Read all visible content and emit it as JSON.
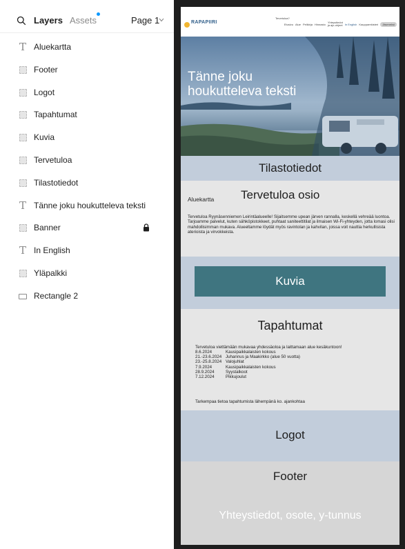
{
  "header": {
    "tab_layers": "Layers",
    "tab_assets": "Assets",
    "page_label": "Page 1"
  },
  "layers": [
    {
      "label": "Aluekartta",
      "icon": "text-icon"
    },
    {
      "label": "Footer",
      "icon": "frame-icon"
    },
    {
      "label": "Logot",
      "icon": "frame-icon"
    },
    {
      "label": "Tapahtumat",
      "icon": "frame-icon"
    },
    {
      "label": "Kuvia",
      "icon": "frame-icon"
    },
    {
      "label": "Tervetuloa",
      "icon": "frame-icon"
    },
    {
      "label": "Tilastotiedot",
      "icon": "frame-icon"
    },
    {
      "label": "Tänne joku houkutteleva teksti",
      "icon": "text-icon"
    },
    {
      "label": "Banner",
      "icon": "frame-icon",
      "locked": true
    },
    {
      "label": "In English",
      "icon": "text-icon"
    },
    {
      "label": "Yläpalkki",
      "icon": "frame-icon"
    },
    {
      "label": "Rectangle 2",
      "icon": "rectangle-icon"
    }
  ],
  "site": {
    "logo": "RAPAPIIRI",
    "nav_over": "Tervetuloa?",
    "nav": [
      "Etusivu",
      "Alue",
      "Pelikirja",
      "Hinnasto"
    ],
    "nav_contact_1": "Yhteystiedot",
    "nav_contact_2": "ja ajo-ohjeet",
    "nav_english": "In English",
    "nav_extra": "Kaupparekisteri",
    "nav_button": "Jäseneksi",
    "hero_text": "Tänne joku\nhoukutteleva teksti",
    "stats_title": "Tilastotiedot",
    "welcome_side": "Aluekartta",
    "welcome_title": "Tervetuloa osio",
    "welcome_body": "Tervetuloa Ryynäsenniemen Leirintäalueelle! Sijaitsemme upean järven rannalla, keskellä vehreää luontoa. Tarjoamme palvelut, kuten sähköpistokkeet, puhtaat saniteettitilat ja ilmaisen Wi-Fi-yhteyden, jotta lomasi olisi mahdollisimman mukava. Alueeltamme löydät myös ravintolan ja kahvilan, joissa voit nauttia herkullisista aterioista ja virvokkeista.",
    "pics_button": "Kuvia",
    "events_title": "Tapahtumat",
    "events_intro": "Tervetuloa viettämään mukavaa yhdessäoloa ja laittamaan alue kesäkuntoon!",
    "events": [
      {
        "date": "8.6.2024",
        "name": "Kausipaikkalaisten kokous"
      },
      {
        "date": "21.-23.6.2024",
        "name": "Juhannus ja Maakirkko (alue 50 vuotta)"
      },
      {
        "date": "23.-25.8.2024",
        "name": "Valojuhlat"
      },
      {
        "date": "7.9.2024",
        "name": "Kausipaikkalaisten kokous"
      },
      {
        "date": "28.9.2024",
        "name": "Syystalkoot"
      },
      {
        "date": "7.12.2024",
        "name": "Pikkujoulut"
      }
    ],
    "events_outro": "Tarkempaa tietoa tapahtumista lähempänä ko. ajankohtaa",
    "logos_title": "Logot",
    "footer_title": "Footer",
    "footer_info": "Yhteystiedot, osote, y-tunnus"
  },
  "colors": {
    "accent": "#0d99ff",
    "section_blue": "#c2cddb",
    "button_teal": "#3f7580",
    "canvas_bg": "#1e1e1e"
  }
}
